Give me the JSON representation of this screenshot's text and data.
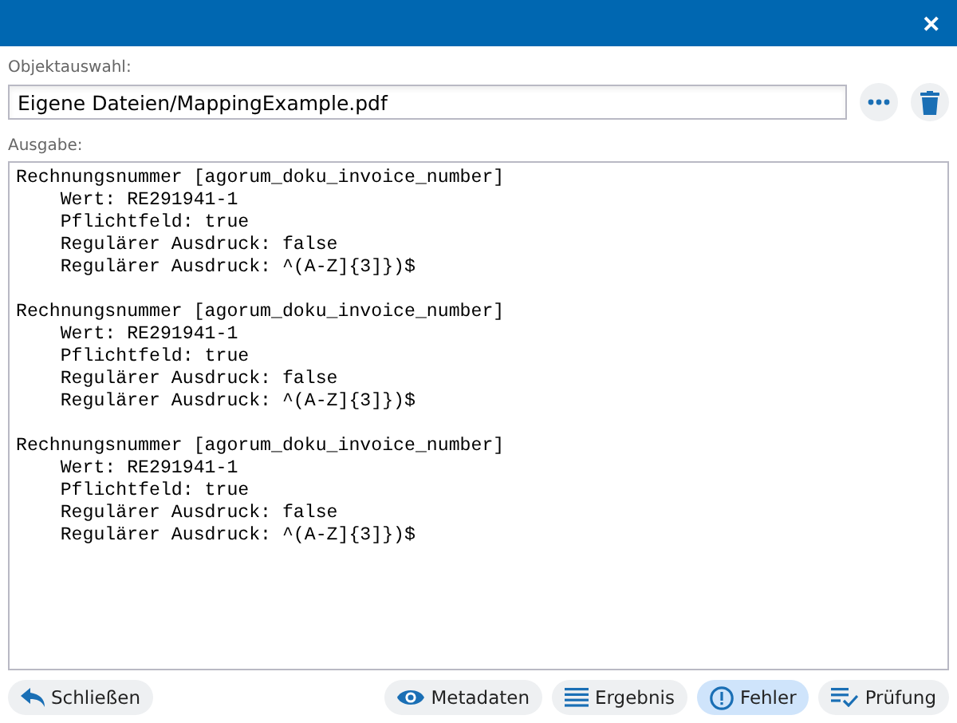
{
  "window": {
    "close_label": "✕"
  },
  "object_selection": {
    "label": "Objektauswahl:",
    "value": "Eigene Dateien/MappingExample.pdf"
  },
  "output": {
    "label": "Ausgabe:",
    "text": "Rechnungsnummer [agorum_doku_invoice_number]\n    Wert: RE291941-1\n    Pflichtfeld: true\n    Regulärer Ausdruck: false\n    Regulärer Ausdruck: ^(A-Z]{3]})$\n\nRechnungsnummer [agorum_doku_invoice_number]\n    Wert: RE291941-1\n    Pflichtfeld: true\n    Regulärer Ausdruck: false\n    Regulärer Ausdruck: ^(A-Z]{3]})$\n\nRechnungsnummer [agorum_doku_invoice_number]\n    Wert: RE291941-1\n    Pflichtfeld: true\n    Regulärer Ausdruck: false\n    Regulärer Ausdruck: ^(A-Z]{3]})$"
  },
  "close_button": {
    "label": "Schließen"
  },
  "view_buttons": [
    {
      "kind": "eye",
      "label": "Metadaten",
      "selected": false
    },
    {
      "kind": "lines",
      "label": "Ergebnis",
      "selected": false
    },
    {
      "kind": "alert",
      "label": "Fehler",
      "selected": true
    },
    {
      "kind": "check",
      "label": "Prüfung",
      "selected": false
    }
  ]
}
